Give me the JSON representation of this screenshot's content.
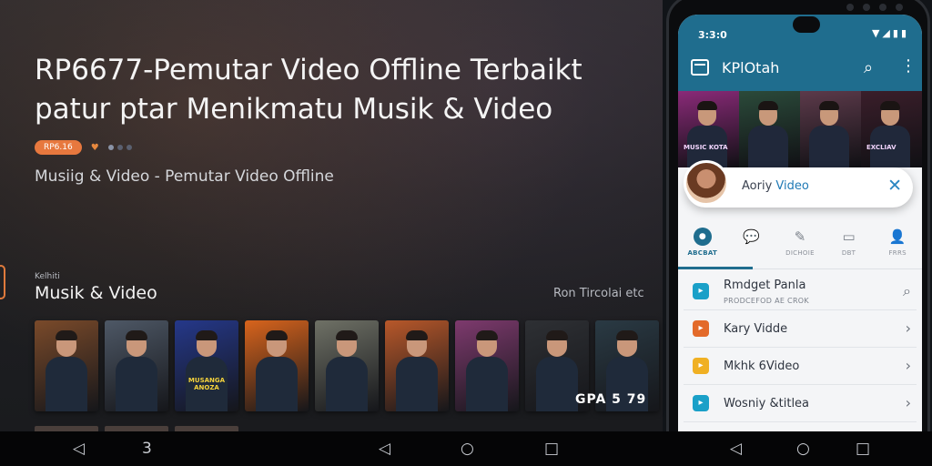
{
  "hero": {
    "title": "RP6677-Pemutar Video Offline Terbaikt patur ptar Menikmatu Musik & Video",
    "badge": "RP6.16",
    "subtitle": "Musiig & Video - Pemutar Video Offline"
  },
  "section": {
    "kicker": "Kelhiti",
    "title": "Musik & Video",
    "right_label": "Ron Tircolai etc",
    "thumb_overlay": "GPA 5 79",
    "thumbs": [
      {
        "bg": "#7a4a2a",
        "poster": ""
      },
      {
        "bg": "#4e5866",
        "poster": ""
      },
      {
        "bg": "#25388a",
        "poster": "MUSANGA ANOZA"
      },
      {
        "bg": "#d8641c",
        "poster": ""
      },
      {
        "bg": "#6f7166",
        "poster": ""
      },
      {
        "bg": "#b8582a",
        "poster": ""
      },
      {
        "bg": "#7e3a6e",
        "poster": ""
      },
      {
        "bg": "#2e3034",
        "poster": ""
      },
      {
        "bg": "#2a3a44",
        "poster": ""
      }
    ]
  },
  "phone": {
    "status_time": "3:3:0",
    "status_icons": "▼◢▮▮",
    "app_title": "KPlOtah",
    "banner": [
      {
        "bg": "#8a2a78",
        "caption": "MUSIC KOTA"
      },
      {
        "bg": "#2b4a3a",
        "caption": ""
      },
      {
        "bg": "#5c3a4a",
        "caption": ""
      },
      {
        "bg": "#3a1e2a",
        "caption": "EXCLIAV"
      }
    ],
    "now_playing": {
      "label_plain": "Aoriy",
      "label_accent": "Video"
    },
    "tabs": [
      {
        "label": "ABCBAT",
        "icon": "●",
        "active": true
      },
      {
        "label": "",
        "icon": "💬",
        "active": false
      },
      {
        "label": "DICHOIE",
        "icon": "✎",
        "active": false
      },
      {
        "label": "DBT",
        "icon": "▭",
        "active": false
      },
      {
        "label": "FRRS",
        "icon": "👤",
        "active": false
      }
    ],
    "list": [
      {
        "title": "Rmdget Panla",
        "subtitle": "PRODCEFOD AE CROK",
        "icon_color": "#1aa0c8",
        "chevron": "⌕"
      },
      {
        "title": "Kary Vidde",
        "subtitle": "",
        "icon_color": "#e36a2a",
        "chevron": "›"
      },
      {
        "title": "Mkhk 6Video",
        "subtitle": "",
        "icon_color": "#f0b023",
        "chevron": "›"
      },
      {
        "title": "Wosniy &titlea",
        "subtitle": "",
        "icon_color": "#1aa0c8",
        "chevron": "›"
      }
    ]
  },
  "navbar": {
    "left_back": "◁",
    "left_extra": "3",
    "right_back": "◁",
    "right_home": "○",
    "right_recents": "□",
    "phone_back": "◁",
    "phone_home": "○",
    "phone_recents": "□"
  }
}
